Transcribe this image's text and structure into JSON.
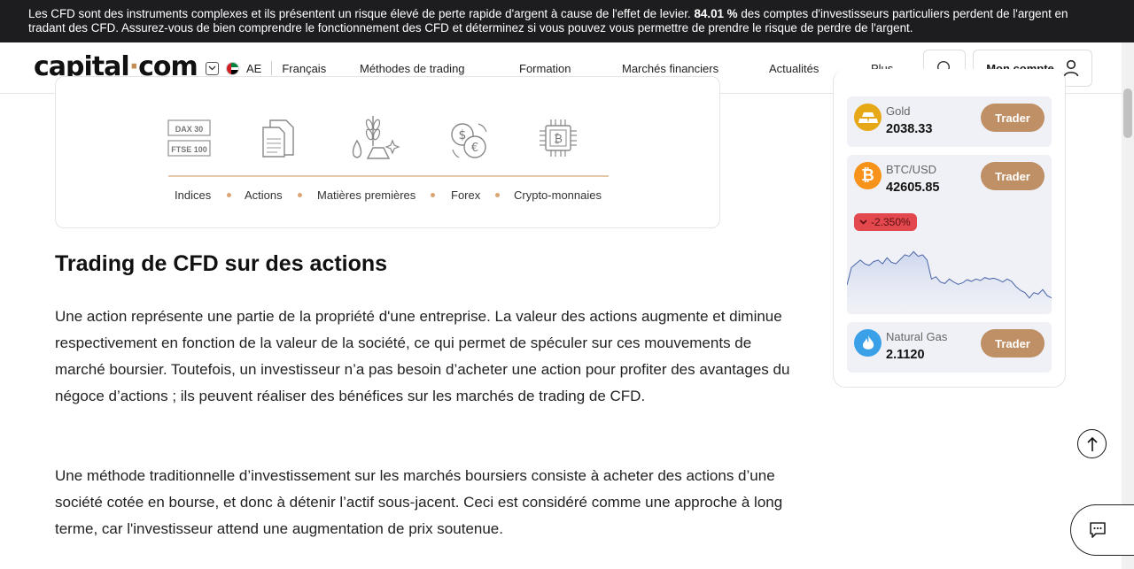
{
  "risk_banner": {
    "text_before": "Les CFD sont des instruments complexes et ils présentent un risque élevé de perte rapide d'argent à cause de l'effet de levier. ",
    "percent": "84.01 %",
    "text_after": " des comptes d'investisseurs particuliers perdent de l'argent en tradant des CFD. Assurez-vous de bien comprendre le fonctionnement des CFD et déterminez si vous pouvez vous permettre de prendre le risque de perdre de l'argent."
  },
  "header": {
    "logo_left": "capital",
    "logo_dot": "·",
    "logo_right": "com",
    "region_code": "AE",
    "language": "Français",
    "nav": [
      "Méthodes de trading",
      "Formation",
      "Marchés financiers",
      "Actualités",
      "Plus"
    ],
    "account_label": "Mon compte"
  },
  "markets": {
    "icon_texts": [
      "DAX 30",
      "FTSE 100"
    ],
    "labels": [
      "Indices",
      "Actions",
      "Matières premières",
      "Forex",
      "Crypto-monnaies"
    ]
  },
  "article": {
    "heading": "Trading de CFD sur des actions",
    "paragraphs": [
      "Une action représente une partie de la propriété d'une entreprise. La valeur des actions augmente et diminue respectivement en fonction de la valeur de la société, ce qui permet de spéculer sur ces mouvements de marché boursier. Toutefois, un investisseur n’a pas besoin d’acheter une action pour profiter des avantages du négoce d’actions ; ils peuvent réaliser des bénéfices sur les marchés de trading de CFD.",
      "Une méthode traditionnelle d’investissement sur les marchés boursiers consiste à acheter des actions d’une société cotée en bourse, et donc à détenir l’actif sous-jacent. Ceci est considéré comme une approche à long terme, car l'investisseur attend une augmentation de prix soutenue."
    ]
  },
  "widget": {
    "assets": [
      {
        "name": "Gold",
        "price": "2038.33",
        "button": "Trader",
        "icon": "gold-bars-icon",
        "color": "#e6a817"
      },
      {
        "name": "BTC/USD",
        "price": "42605.85",
        "button": "Trader",
        "icon": "bitcoin-icon",
        "color": "#f7931a",
        "change": "-2.350%"
      },
      {
        "name": "Natural Gas",
        "price": "2.1120",
        "button": "Trader",
        "icon": "flame-icon",
        "color": "#3aa0e8"
      }
    ],
    "sparkline": [
      0.22,
      0.45,
      0.5,
      0.55,
      0.5,
      0.48,
      0.53,
      0.55,
      0.5,
      0.58,
      0.52,
      0.5,
      0.56,
      0.62,
      0.6,
      0.66,
      0.6,
      0.62,
      0.55,
      0.3,
      0.33,
      0.26,
      0.24,
      0.3,
      0.26,
      0.23,
      0.25,
      0.29,
      0.27,
      0.3,
      0.28,
      0.32,
      0.3,
      0.31,
      0.29,
      0.26,
      0.3,
      0.27,
      0.2,
      0.15,
      0.12,
      0.05,
      0.12,
      0.1,
      0.16,
      0.08,
      0.05
    ],
    "accent": "#bf8f65",
    "down_color": "#e2484d"
  }
}
